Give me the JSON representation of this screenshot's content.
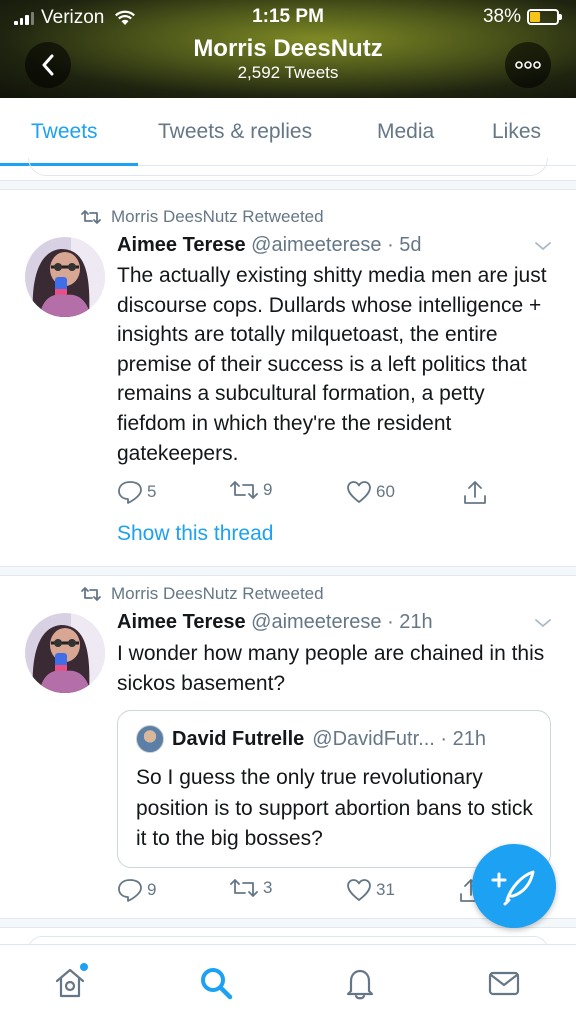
{
  "status_bar": {
    "carrier": "Verizon",
    "time": "1:15 PM",
    "battery": "38%"
  },
  "profile": {
    "name": "Morris DeesNutz",
    "tweet_count": "2,592 Tweets"
  },
  "tabs": [
    {
      "label": "Tweets",
      "active": true
    },
    {
      "label": "Tweets & replies",
      "active": false
    },
    {
      "label": "Media",
      "active": false
    },
    {
      "label": "Likes",
      "active": false
    }
  ],
  "tweets": [
    {
      "retweeted_by": "Morris DeesNutz Retweeted",
      "name": "Aimee Terese",
      "handle": "@aimeeterese · 5d",
      "text": "The actually existing shitty media men are just discourse cops. Dullards whose intelligence + insights are totally milquetoast, the entire premise of their success is a left politics that remains a subcultural formation, a petty fiefdom in which they're the resident gatekeepers.",
      "replies": "5",
      "retweets": "9",
      "likes": "60",
      "show_thread": "Show this thread"
    },
    {
      "retweeted_by": "Morris DeesNutz Retweeted",
      "name": "Aimee Terese",
      "handle": "@aimeeterese · 21h",
      "text": "I wonder how many people are chained in this sickos basement?",
      "quote": {
        "name": "David Futrelle",
        "handle": "@DavidFutr... · 21h",
        "text": "So I guess the only true revolutionary position is to support abortion bans to stick it to the big bosses?"
      },
      "replies": "9",
      "retweets": "3",
      "likes": "31"
    }
  ],
  "colors": {
    "accent": "#1da1f2",
    "muted": "#657786",
    "text": "#14171a"
  },
  "icons": [
    "back-icon",
    "more-icon",
    "retweet-icon",
    "reply-icon",
    "like-icon",
    "share-icon",
    "compose-icon",
    "home-icon",
    "search-icon",
    "notifications-icon",
    "messages-icon"
  ]
}
